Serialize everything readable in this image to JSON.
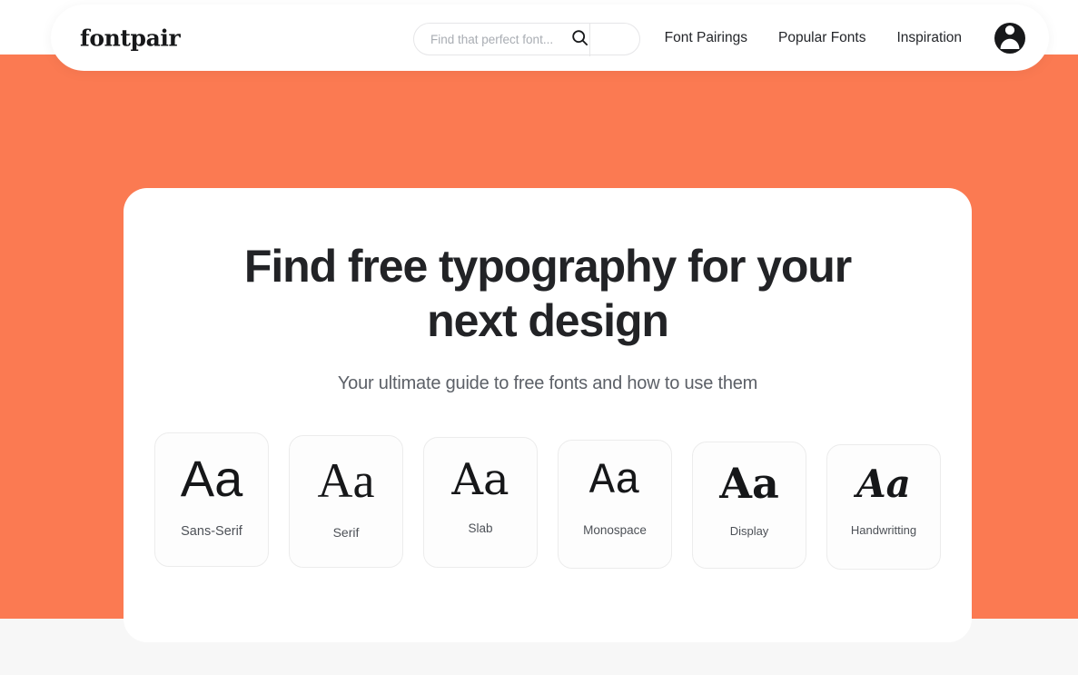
{
  "theme": {
    "accent_orange": "#FB7A52",
    "page_white": "#FFFFFF",
    "footer_grey": "#F7F7F7",
    "text_dark": "#222326",
    "text_muted": "#5C6067",
    "card_border": "#ECECEC"
  },
  "header": {
    "logo": "fontpair",
    "search": {
      "placeholder": "Find that perfect font...",
      "value": "",
      "icon": "search-icon"
    },
    "nav": [
      {
        "label": "Font Pairings"
      },
      {
        "label": "Popular Fonts"
      },
      {
        "label": "Inspiration"
      }
    ],
    "account": {
      "icon": "avatar-person-icon",
      "label": ""
    }
  },
  "hero": {
    "title_line_1": "Find free typography for your",
    "title_line_2": "next design",
    "subtitle": "Your ultimate guide to free fonts and how to use them"
  },
  "categories": [
    {
      "glyph": "Aa",
      "label": "Sans-Serif"
    },
    {
      "glyph": "Aa",
      "label": "Serif"
    },
    {
      "glyph": "Aa",
      "label": "Slab"
    },
    {
      "glyph": "Aa",
      "label": "Monospace"
    },
    {
      "glyph": "Aa",
      "label": "Display"
    },
    {
      "glyph": "Aa",
      "label": "Handwritting"
    }
  ]
}
